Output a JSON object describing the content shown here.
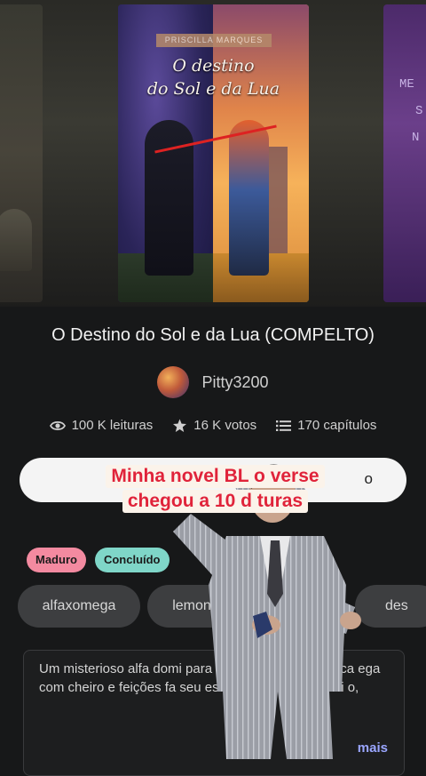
{
  "covers": {
    "main": {
      "author_band": "PRISCILLA MARQUES",
      "title_line1": "O destino",
      "title_line2": "do Sol e da Lua"
    },
    "right_partial": [
      "ME",
      "S",
      "N"
    ]
  },
  "story": {
    "title": "O Destino do Sol e da Lua (COMPELTO)",
    "author": "Pitty3200"
  },
  "stats": {
    "reads": "100 K leituras",
    "votes": "16 K votos",
    "chapters": "170 capítulos"
  },
  "action_button": {
    "tail_text": "o"
  },
  "overlay_caption": {
    "line1": "Minha novel BL o   verse",
    "line2": "chegou a 10   d   turas"
  },
  "badges": {
    "mature": "Maduro",
    "completed": "Concluído"
  },
  "tags": [
    "alfaxomega",
    "lemon",
    "des"
  ],
  "description": {
    "text": "Um misterioso alfa domi                        para evitar feromônios e aca                      ega com cheiro e feições fa                          seu esforço ele reage e enti                        o,",
    "more_label": "mais"
  },
  "colors": {
    "background": "#171819",
    "mature_badge": "#f38aa0",
    "completed_badge": "#7fd6c8",
    "caption_red": "#e0233a",
    "link_blue": "#9aa6ff"
  }
}
